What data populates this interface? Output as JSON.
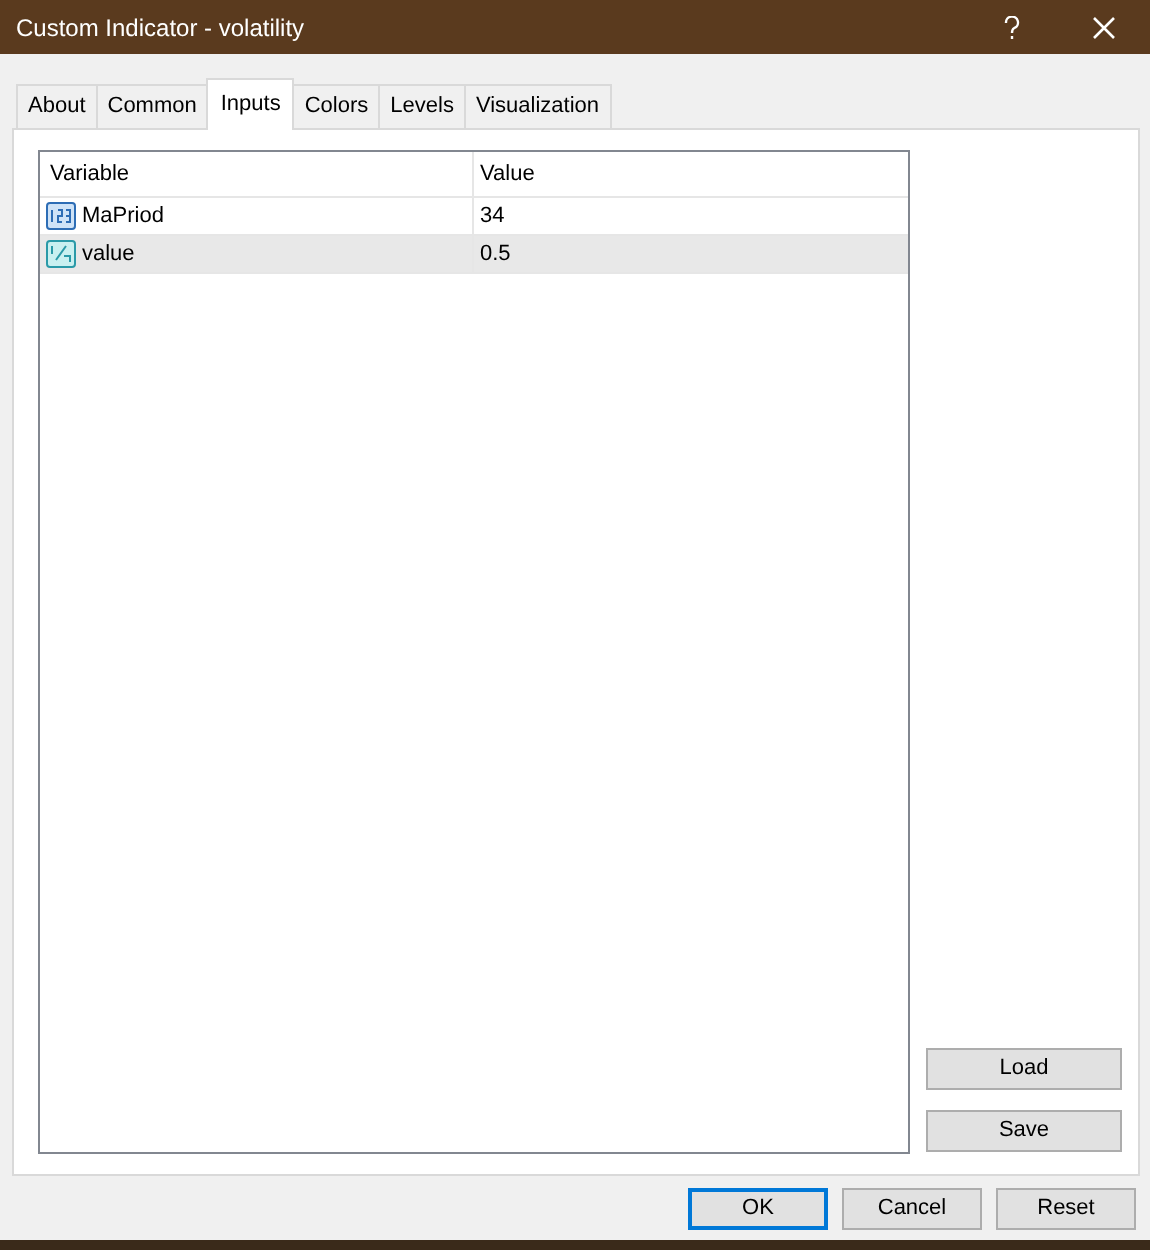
{
  "window": {
    "title": "Custom Indicator - volatility"
  },
  "tabs": [
    {
      "label": "About",
      "selected": false
    },
    {
      "label": "Common",
      "selected": false
    },
    {
      "label": "Inputs",
      "selected": true
    },
    {
      "label": "Colors",
      "selected": false
    },
    {
      "label": "Levels",
      "selected": false
    },
    {
      "label": "Visualization",
      "selected": false
    }
  ],
  "table": {
    "columns": [
      "Variable",
      "Value"
    ],
    "rows": [
      {
        "kind": "integer",
        "variable": "MaPriod",
        "value": "34",
        "selected": false
      },
      {
        "kind": "double",
        "variable": "value",
        "value": "0.5",
        "selected": true
      }
    ]
  },
  "side_buttons": [
    "Load",
    "Save"
  ],
  "buttons": [
    {
      "label": "OK",
      "default": true
    },
    {
      "label": "Cancel",
      "default": false
    },
    {
      "label": "Reset",
      "default": false
    }
  ]
}
